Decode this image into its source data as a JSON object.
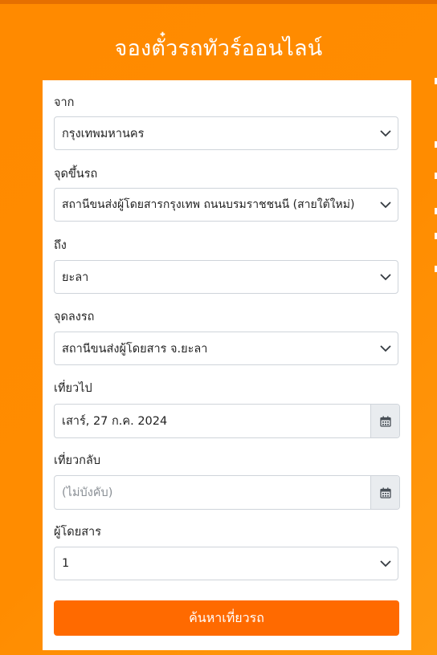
{
  "page": {
    "title": "จองตั๋วรถทัวร์ออนไลน์",
    "accent_color": "#ff8c00",
    "button_color": "#ff6a00"
  },
  "form": {
    "from": {
      "label": "จาก",
      "value": "กรุงเทพมหานคร"
    },
    "pickup": {
      "label": "จุดขึ้นรถ",
      "value": "สถานีขนส่งผู้โดยสารกรุงเทพ ถนนบรมราชชนนี (สายใต้ใหม่)"
    },
    "to": {
      "label": "ถึง",
      "value": "ยะลา"
    },
    "dropoff": {
      "label": "จุดลงรถ",
      "value": "สถานีขนส่งผู้โดยสาร จ.ยะลา"
    },
    "depart": {
      "label": "เที่ยวไป",
      "value": "เสาร์, 27 ก.ค. 2024",
      "icon": "calendar-icon"
    },
    "return": {
      "label": "เที่ยวกลับ",
      "placeholder": "(ไม่บังคับ)",
      "icon": "calendar-icon"
    },
    "passengers": {
      "label": "ผู้โดยสาร",
      "value": "1"
    },
    "search_button": "ค้นหาเที่ยวรถ"
  }
}
